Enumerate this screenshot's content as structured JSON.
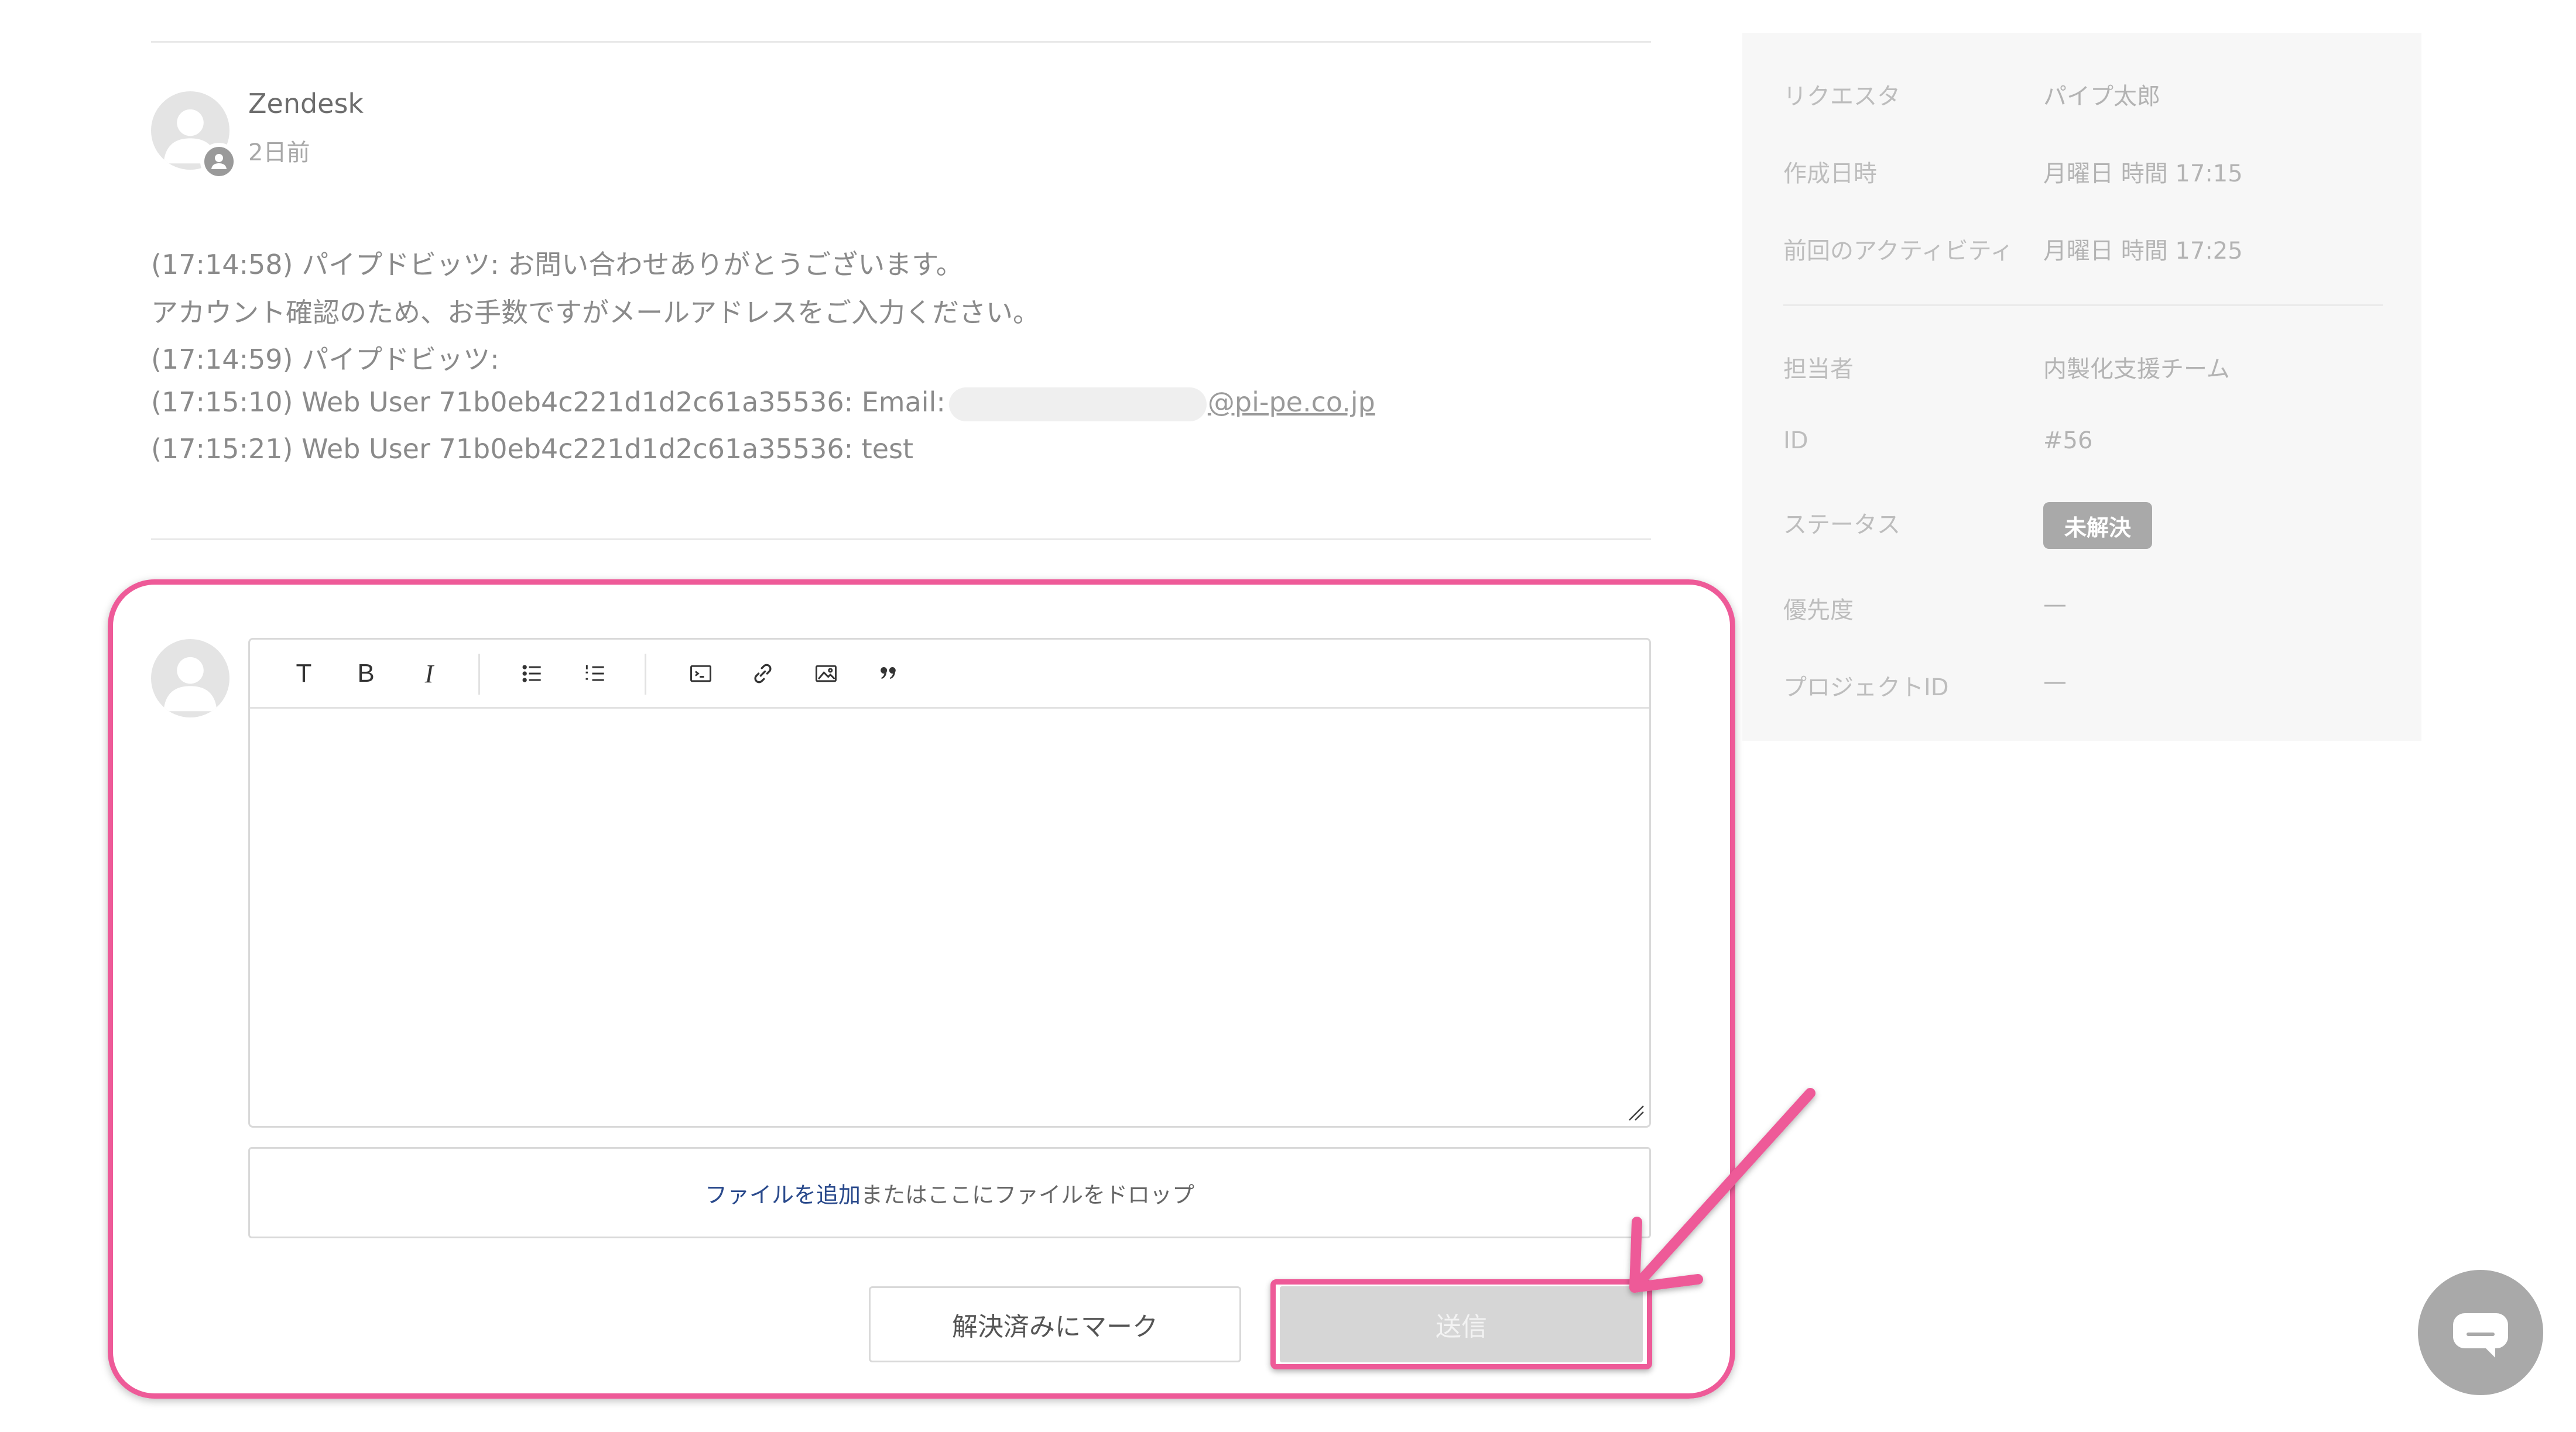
{
  "comment": {
    "author": "Zendesk",
    "time_ago": "2日前",
    "lines": [
      "(17:14:58) パイプドビッツ: お問い合わせありがとうございます。",
      "アカウント確認のため、お手数ですがメールアドレスをご入力ください。",
      "(17:14:59) パイプドビッツ:",
      "(17:15:10) Web User 71b0eb4c221d1d2c61a35536: Email:",
      "(17:15:21) Web User 71b0eb4c221d1d2c61a35536: test"
    ],
    "email_domain": "@pi-pe.co.jp"
  },
  "editor": {
    "toolbar": [
      {
        "name": "text-style-icon",
        "glyph": "T"
      },
      {
        "name": "bold-icon",
        "glyph": "B"
      },
      {
        "name": "italic-icon",
        "glyph": "I"
      },
      {
        "name": "bulleted-list-icon"
      },
      {
        "name": "numbered-list-icon"
      },
      {
        "name": "code-block-icon"
      },
      {
        "name": "link-icon"
      },
      {
        "name": "image-icon"
      },
      {
        "name": "quote-icon"
      }
    ],
    "body_value": ""
  },
  "attachments": {
    "add_link": "ファイルを追加",
    "hint": "またはここにファイルをドロップ"
  },
  "actions": {
    "mark_solved": "解決済みにマーク",
    "send": "送信"
  },
  "details": {
    "requester_label": "リクエスタ",
    "requester_value": "パイプ太郎",
    "created_label": "作成日時",
    "created_value": "月曜日 時間 17:15",
    "last_activity_label": "前回のアクティビティ",
    "last_activity_value": "月曜日 時間 17:25",
    "assignee_label": "担当者",
    "assignee_value": "内製化支援チーム",
    "id_label": "ID",
    "id_value": "#56",
    "status_label": "ステータス",
    "status_value": "未解決",
    "priority_label": "優先度",
    "priority_value": "—",
    "project_label": "プロジェクトID",
    "project_value": "—"
  },
  "colors": {
    "highlight": "#ee5a98",
    "link": "#2a4a8c",
    "send_disabled": "#d6d6d6",
    "status_badge": "#a9a9a9"
  }
}
